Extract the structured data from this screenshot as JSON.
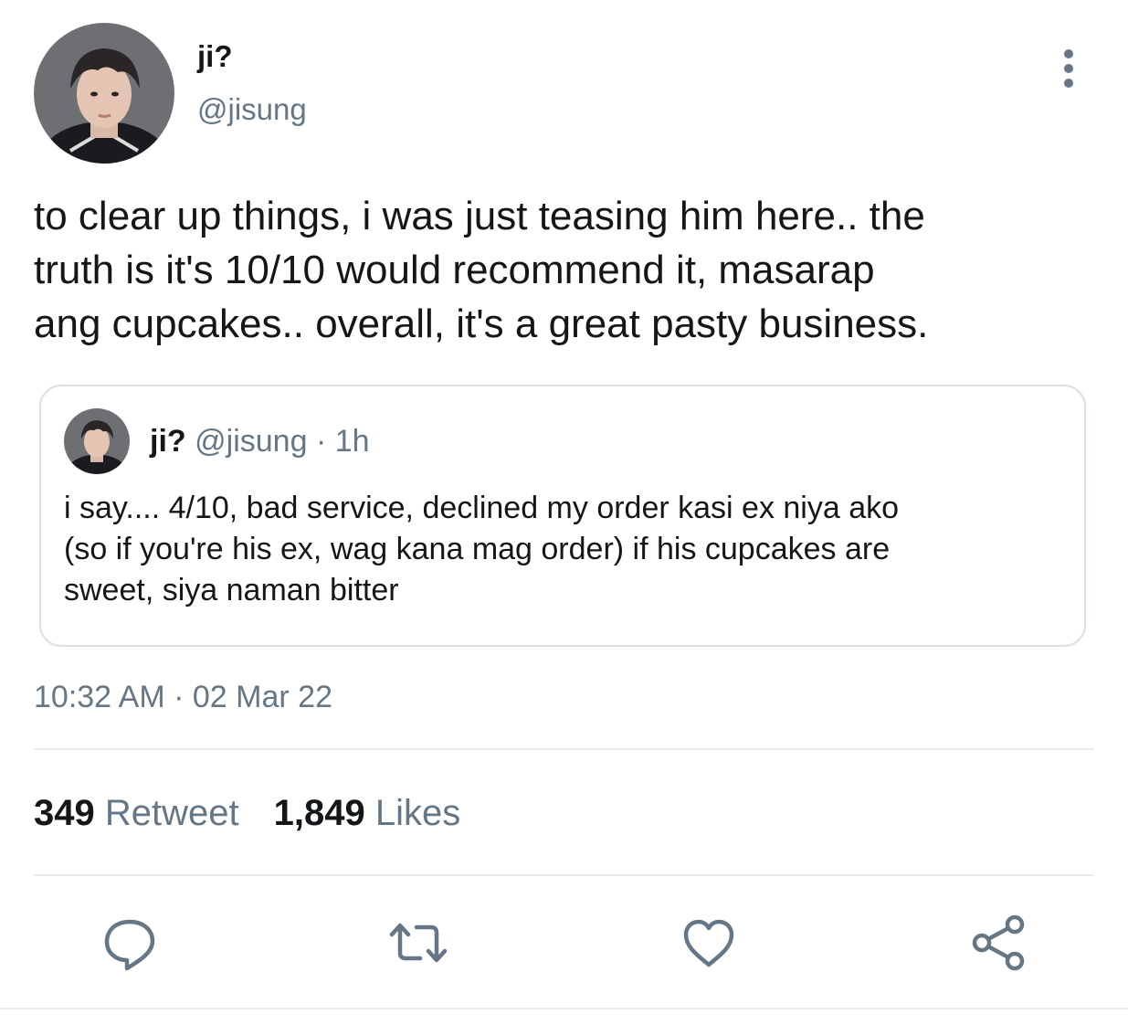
{
  "tweet": {
    "author": {
      "display_name": "ji?",
      "handle": "@jisung"
    },
    "text": "to clear up things, i was just teasing him here.. the\ntruth is it's 10/10 would recommend it, masarap\nang cupcakes.. overall, it's a great pasty business.",
    "quoted_tweet": {
      "display_name": "ji?",
      "handle": "@jisung",
      "separator": "·",
      "time_ago": "1h",
      "text": "i say.... 4/10, bad service, declined my order kasi ex niya ako\n(so if you're his ex, wag kana mag order) if his cupcakes are\nsweet, siya naman bitter"
    },
    "timestamp": {
      "time": "10:32 AM",
      "separator": "·",
      "date": "02 Mar 22"
    },
    "stats": {
      "retweets_count": "349",
      "retweets_label": "Retweet",
      "likes_count": "1,849",
      "likes_label": "Likes"
    },
    "actions": [
      "reply-icon",
      "retweet-icon",
      "like-icon",
      "share-icon"
    ],
    "colors": {
      "text_primary": "#14171a",
      "text_secondary": "#657786",
      "border": "#d9dfe4",
      "divider": "#e6ecf0",
      "icon": "#657786"
    }
  }
}
